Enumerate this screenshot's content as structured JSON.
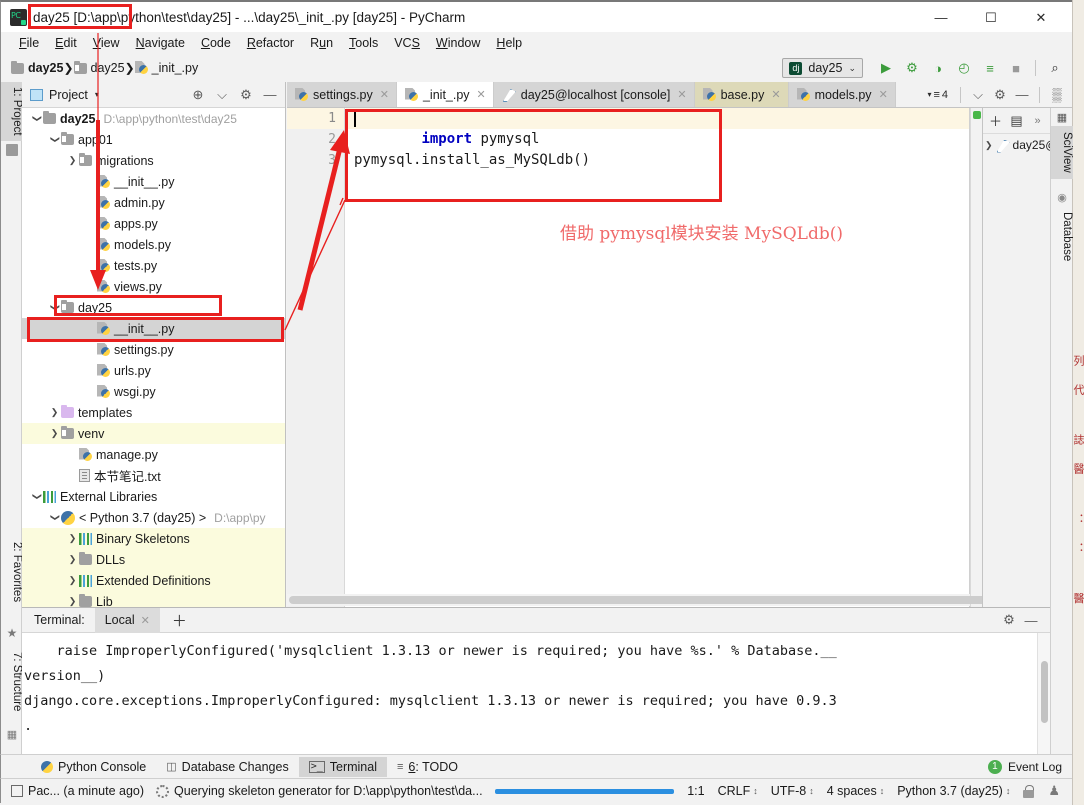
{
  "window": {
    "title": "day25 [D:\\app\\python\\test\\day25] - ...\\day25\\_init_.py [day25] - PyCharm",
    "minimize": "—",
    "maximize": "☐",
    "close": "✕"
  },
  "menubar": [
    {
      "label": "File"
    },
    {
      "label": "Edit"
    },
    {
      "label": "View"
    },
    {
      "label": "Navigate"
    },
    {
      "label": "Code"
    },
    {
      "label": "Refactor"
    },
    {
      "label": "Run"
    },
    {
      "label": "Tools"
    },
    {
      "label": "VCS"
    },
    {
      "label": "Window"
    },
    {
      "label": "Help"
    }
  ],
  "breadcrumb": [
    {
      "label": "day25",
      "icon": "folder-icon"
    },
    {
      "label": "day25",
      "icon": "folder-module-icon"
    },
    {
      "label": "_init_.py",
      "icon": "python-file-icon"
    }
  ],
  "run_toolbar": {
    "config_name": "day25",
    "config_badge": "dj",
    "chevron": "⌄",
    "buttons": [
      {
        "name": "run-button",
        "glyph": "▶"
      },
      {
        "name": "debug-button",
        "glyph": "⚙"
      },
      {
        "name": "run-coverage-button",
        "glyph": "◑"
      },
      {
        "name": "profile-button",
        "glyph": "◴"
      },
      {
        "name": "run-with-params-button",
        "glyph": "≡"
      },
      {
        "name": "stop-button",
        "glyph": "■"
      },
      {
        "name": "search-everywhere-button",
        "glyph": "⌕"
      }
    ]
  },
  "left_strip": [
    {
      "label": "1: Project",
      "active": true
    },
    {
      "label": "2: Favorites",
      "active": false
    },
    {
      "label": "7: Structure",
      "active": false
    }
  ],
  "right_strip": [
    {
      "label": "SciView",
      "active": true
    },
    {
      "label": "Database",
      "active": false
    }
  ],
  "project_panel": {
    "title": "Project",
    "caret": "▾",
    "icons": [
      {
        "name": "locate-icon",
        "glyph": "⊕"
      },
      {
        "name": "collapse-all-icon",
        "glyph": "⌵"
      },
      {
        "name": "settings-gear-icon",
        "glyph": "⚙"
      },
      {
        "name": "hide-icon",
        "glyph": "—"
      }
    ],
    "tree": [
      {
        "depth": 0,
        "arrow": "open",
        "icon": "folder-icon",
        "label": "day25",
        "bold": true,
        "path": "D:\\app\\python\\test\\day25",
        "state": "normal"
      },
      {
        "depth": 1,
        "arrow": "open",
        "icon": "folder-module-icon",
        "label": "app01",
        "bold": false,
        "path": "",
        "state": "normal"
      },
      {
        "depth": 2,
        "arrow": "closed",
        "icon": "folder-module-icon",
        "label": "migrations",
        "bold": false,
        "path": "",
        "state": "normal"
      },
      {
        "depth": 3,
        "arrow": "none",
        "icon": "python-file-icon",
        "label": "__init__.py",
        "bold": false,
        "path": "",
        "state": "normal"
      },
      {
        "depth": 3,
        "arrow": "none",
        "icon": "python-file-icon",
        "label": "admin.py",
        "bold": false,
        "path": "",
        "state": "normal"
      },
      {
        "depth": 3,
        "arrow": "none",
        "icon": "python-file-icon",
        "label": "apps.py",
        "bold": false,
        "path": "",
        "state": "normal"
      },
      {
        "depth": 3,
        "arrow": "none",
        "icon": "python-file-icon",
        "label": "models.py",
        "bold": false,
        "path": "",
        "state": "normal"
      },
      {
        "depth": 3,
        "arrow": "none",
        "icon": "python-file-icon",
        "label": "tests.py",
        "bold": false,
        "path": "",
        "state": "normal"
      },
      {
        "depth": 3,
        "arrow": "none",
        "icon": "python-file-icon",
        "label": "views.py",
        "bold": false,
        "path": "",
        "state": "normal"
      },
      {
        "depth": 1,
        "arrow": "open",
        "icon": "folder-module-icon",
        "label": "day25",
        "bold": false,
        "path": "",
        "state": "normal"
      },
      {
        "depth": 3,
        "arrow": "none",
        "icon": "python-file-icon",
        "label": "__init__.py",
        "bold": false,
        "path": "",
        "state": "selected"
      },
      {
        "depth": 3,
        "arrow": "none",
        "icon": "python-file-icon",
        "label": "settings.py",
        "bold": false,
        "path": "",
        "state": "normal"
      },
      {
        "depth": 3,
        "arrow": "none",
        "icon": "python-file-icon",
        "label": "urls.py",
        "bold": false,
        "path": "",
        "state": "normal"
      },
      {
        "depth": 3,
        "arrow": "none",
        "icon": "python-file-icon",
        "label": "wsgi.py",
        "bold": false,
        "path": "",
        "state": "normal"
      },
      {
        "depth": 1,
        "arrow": "closed",
        "icon": "folder-purple-icon",
        "label": "templates",
        "bold": false,
        "path": "",
        "state": "normal"
      },
      {
        "depth": 1,
        "arrow": "closed",
        "icon": "folder-module-icon",
        "label": "venv",
        "bold": false,
        "path": "",
        "state": "highlight"
      },
      {
        "depth": 2,
        "arrow": "none",
        "icon": "python-file-icon",
        "label": "manage.py",
        "bold": false,
        "path": "",
        "state": "normal"
      },
      {
        "depth": 2,
        "arrow": "none",
        "icon": "text-file-icon",
        "label": "本节笔记.txt",
        "bold": false,
        "path": "",
        "state": "normal"
      },
      {
        "depth": 0,
        "arrow": "open",
        "icon": "library-icon",
        "label": "External Libraries",
        "bold": false,
        "path": "",
        "state": "normal"
      },
      {
        "depth": 1,
        "arrow": "open",
        "icon": "python-logo-icon",
        "label": "< Python 3.7 (day25) >",
        "bold": false,
        "path": "D:\\app\\py",
        "state": "normal"
      },
      {
        "depth": 2,
        "arrow": "closed",
        "icon": "library-icon",
        "label": "Binary Skeletons",
        "bold": false,
        "path": "",
        "state": "highlight"
      },
      {
        "depth": 2,
        "arrow": "closed",
        "icon": "folder-icon",
        "label": "DLLs",
        "bold": false,
        "path": "",
        "state": "highlight"
      },
      {
        "depth": 2,
        "arrow": "closed",
        "icon": "library-icon",
        "label": "Extended Definitions",
        "bold": false,
        "path": "",
        "state": "highlight"
      },
      {
        "depth": 2,
        "arrow": "closed",
        "icon": "folder-icon",
        "label": "Lib",
        "bold": false,
        "path": "",
        "state": "highlight"
      }
    ]
  },
  "editor_tabs": [
    {
      "label": "settings.py",
      "icon": "python-file-icon",
      "state": "grey",
      "close": "✕"
    },
    {
      "label": "_init_.py",
      "icon": "python-file-icon",
      "state": "active",
      "close": "✕"
    },
    {
      "label": "day25@localhost [console]",
      "icon": "console-icon",
      "state": "grey",
      "close": "✕"
    },
    {
      "label": "base.py",
      "icon": "python-file-icon",
      "state": "olive",
      "close": "✕"
    },
    {
      "label": "models.py",
      "icon": "python-file-icon",
      "state": "grey",
      "close": "✕"
    }
  ],
  "editor_tabs_right": {
    "count": "4",
    "count_glyph": "≡",
    "collapse_glyph": "⌵",
    "gear_glyph": "⚙",
    "hide_glyph": "—",
    "grid_glyph": "▒"
  },
  "editor": {
    "line_numbers": [
      "1",
      "2",
      "3"
    ],
    "lines": [
      {
        "tokens": [
          {
            "t": "import",
            "k": "kw"
          },
          {
            "t": " pymysql",
            "k": ""
          }
        ]
      },
      {
        "tokens": []
      },
      {
        "tokens": [
          {
            "t": "pymysql.install_as_MySQLdb()",
            "k": ""
          }
        ]
      }
    ],
    "annotation_note": "借助 pymysql模块安装 MySQLdb()"
  },
  "console_panel": {
    "toolbar": [
      {
        "name": "new-console-icon",
        "glyph": "＋"
      },
      {
        "name": "copy-icon",
        "glyph": "▤"
      },
      {
        "name": "expand-icon",
        "glyph": "»"
      }
    ],
    "rows": [
      {
        "arrow": "❯",
        "icon": "console-icon",
        "label": "day25@"
      }
    ]
  },
  "terminal": {
    "header_label": "Terminal:",
    "tab_label": "Local",
    "tab_close": "✕",
    "add_tab": "＋",
    "settings_glyph": "⚙",
    "hide_glyph": "—",
    "output": [
      "    raise ImproperlyConfigured('mysqlclient 1.3.13 or newer is required; you have %s.' % Database.__",
      "version__)",
      "django.core.exceptions.ImproperlyConfigured: mysqlclient 1.3.13 or newer is required; you have 0.9.3",
      "."
    ]
  },
  "bottom_bar": {
    "buttons": [
      {
        "label": "Python Console",
        "icon": "python-console-icon",
        "active": false
      },
      {
        "label": "Database Changes",
        "icon": "database-changes-icon",
        "active": false
      },
      {
        "label": "Terminal",
        "icon": "terminal-icon",
        "active": true
      },
      {
        "label": "6: TODO",
        "icon": "todo-icon",
        "active": false
      }
    ],
    "event_log_label": "Event Log",
    "event_log_count": "1"
  },
  "status_bar": {
    "left_items": [
      {
        "name": "package-status",
        "label": "Pac... (a minute ago)"
      },
      {
        "name": "background-task",
        "label": "Querying skeleton generator for D:\\app\\python\\test\\da..."
      }
    ],
    "right_items": [
      {
        "name": "caret-position",
        "label": "1:1",
        "arrows": ""
      },
      {
        "name": "line-separator",
        "label": "CRLF",
        "arrows": "↕"
      },
      {
        "name": "file-encoding",
        "label": "UTF-8",
        "arrows": "↕"
      },
      {
        "name": "indent-setting",
        "label": "4 spaces",
        "arrows": "↕"
      },
      {
        "name": "python-interpreter",
        "label": "Python 3.7 (day25)",
        "arrows": "↕"
      }
    ]
  },
  "colors": {
    "accent_red": "#e8201f",
    "note_red": "#f06a6a",
    "selection_grey": "#d4d4d4",
    "highlight_yellow": "#fbfbdd",
    "current_line": "#fdf6e3",
    "progress_blue": "#2b8fe0",
    "keyword_blue": "#0000c0"
  }
}
